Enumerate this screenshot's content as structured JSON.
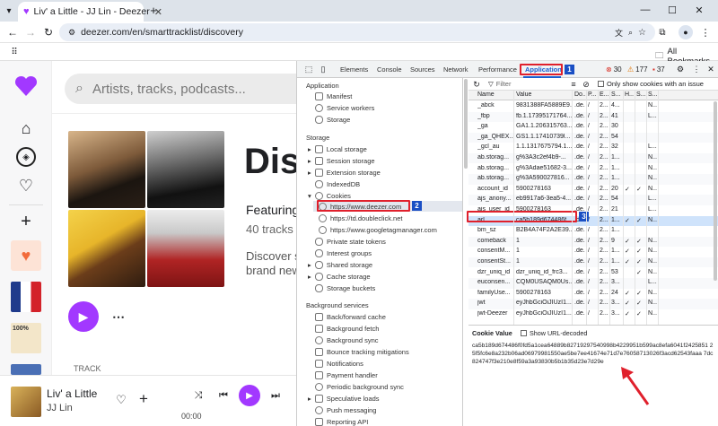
{
  "browser": {
    "tab_title": "Liv' a Little - JJ Lin - Deezer",
    "url": "deezer.com/en/smarttracklist/discovery",
    "bookmarks_label": "All Bookmarks"
  },
  "deezer": {
    "search_placeholder": "Artists, tracks, podcasts...",
    "page_title": "Dis",
    "featuring": "Featuring",
    "tracks_count": "40 tracks",
    "discover_line1": "Discover s",
    "discover_line2": "brand new",
    "track_header": "TRACK",
    "thumb_label": "100%",
    "player": {
      "song": "Liv' a Little",
      "artist": "JJ Lin",
      "time": "00:00"
    }
  },
  "devtools": {
    "tabs": [
      "Elements",
      "Console",
      "Sources",
      "Network",
      "Performance",
      "Application"
    ],
    "errors": "30",
    "warnings": "177",
    "issues": "37",
    "left": {
      "application_header": "Application",
      "application_items": [
        "Manifest",
        "Service workers",
        "Storage"
      ],
      "storage_header": "Storage",
      "storage_items": [
        "Local storage",
        "Session storage",
        "Extension storage",
        "IndexedDB",
        "Cookies"
      ],
      "cookie_items": [
        "https://www.deezer.com",
        "https://td.doubleclick.net",
        "https://www.googletagmanager.com"
      ],
      "storage_items2": [
        "Private state tokens",
        "Interest groups",
        "Shared storage",
        "Cache storage",
        "Storage buckets"
      ],
      "bg_header": "Background services",
      "bg_items": [
        "Back/forward cache",
        "Background fetch",
        "Background sync",
        "Bounce tracking mitigations",
        "Notifications",
        "Payment handler",
        "Periodic background sync",
        "Speculative loads",
        "Push messaging",
        "Reporting API"
      ]
    },
    "cookies_toolbar": {
      "filter_label": "Filter",
      "only_issue_label": "Only show cookies with an issue"
    },
    "columns": [
      "Name",
      "Value",
      "Do...",
      "P...",
      "E...",
      "S...",
      "H...",
      "S...",
      "S..."
    ],
    "rows": [
      {
        "name": "_abck",
        "value": "9831388FA5889E9...",
        "d": ".de...",
        "p": "/",
        "e": "2...",
        "s": "4...",
        "h": "",
        "sc": "",
        "ss": "N..."
      },
      {
        "name": "_fbp",
        "value": "fb.1.17395171764...",
        "d": ".de...",
        "p": "/",
        "e": "2...",
        "s": "41",
        "h": "",
        "sc": "",
        "ss": "L..."
      },
      {
        "name": "_ga",
        "value": "GA1.1.206315763...",
        "d": ".de...",
        "p": "/",
        "e": "2...",
        "s": "30",
        "h": "",
        "sc": "",
        "ss": ""
      },
      {
        "name": "_ga_QHEX...",
        "value": "GS1.1.17410739l...",
        "d": ".de...",
        "p": "/",
        "e": "2...",
        "s": "54",
        "h": "",
        "sc": "",
        "ss": ""
      },
      {
        "name": "_gcl_au",
        "value": "1.1.1317675794.1...",
        "d": ".de...",
        "p": "/",
        "e": "2...",
        "s": "32",
        "h": "",
        "sc": "",
        "ss": "L..."
      },
      {
        "name": "ab.storag...",
        "value": "g%3A3c2ef4b9-...",
        "d": ".de...",
        "p": "/",
        "e": "2...",
        "s": "1...",
        "h": "",
        "sc": "",
        "ss": "N..."
      },
      {
        "name": "ab.storag...",
        "value": "g%3Adae51682-3...",
        "d": ".de...",
        "p": "/",
        "e": "2...",
        "s": "1...",
        "h": "",
        "sc": "",
        "ss": "N..."
      },
      {
        "name": "ab.storag...",
        "value": "g%3A590027816...",
        "d": ".de...",
        "p": "/",
        "e": "2...",
        "s": "1...",
        "h": "",
        "sc": "",
        "ss": "N..."
      },
      {
        "name": "account_id",
        "value": "5900278163",
        "d": ".de...",
        "p": "/",
        "e": "2...",
        "s": "20",
        "h": "✓",
        "sc": "✓",
        "ss": "N..."
      },
      {
        "name": "ajs_anony...",
        "value": "eb9917a6-3ea5-4...",
        "d": ".de...",
        "p": "/",
        "e": "2...",
        "s": "54",
        "h": "",
        "sc": "",
        "ss": "L..."
      },
      {
        "name": "ajs_user_id",
        "value": "5900278163",
        "d": ".de...",
        "p": "/",
        "e": "2...",
        "s": "21",
        "h": "",
        "sc": "",
        "ss": "L..."
      },
      {
        "name": "arl",
        "value": "ca5b189d674486f...",
        "d": ".de...",
        "p": "/",
        "e": "2...",
        "s": "1...",
        "h": "✓",
        "sc": "✓",
        "ss": "N..."
      },
      {
        "name": "bm_sz",
        "value": "B2B4A74F2A2E39...",
        "d": ".de...",
        "p": "/",
        "e": "2...",
        "s": "1...",
        "h": "",
        "sc": "",
        "ss": ""
      },
      {
        "name": "comeback",
        "value": "1",
        "d": ".de...",
        "p": "/",
        "e": "2...",
        "s": "9",
        "h": "✓",
        "sc": "✓",
        "ss": "N..."
      },
      {
        "name": "consentM...",
        "value": "1",
        "d": ".de...",
        "p": "/",
        "e": "2...",
        "s": "1...",
        "h": "✓",
        "sc": "✓",
        "ss": "N..."
      },
      {
        "name": "consentSt...",
        "value": "1",
        "d": ".de...",
        "p": "/",
        "e": "2...",
        "s": "1...",
        "h": "✓",
        "sc": "✓",
        "ss": "N..."
      },
      {
        "name": "dzr_uniq_id",
        "value": "dzr_uniq_id_frc3...",
        "d": ".de...",
        "p": "/",
        "e": "2...",
        "s": "53",
        "h": "",
        "sc": "✓",
        "ss": "N..."
      },
      {
        "name": "euconsen...",
        "value": "CQM0USAQM0Us...",
        "d": ".de...",
        "p": "/",
        "e": "2...",
        "s": "3...",
        "h": "",
        "sc": "",
        "ss": "L..."
      },
      {
        "name": "familyUse...",
        "value": "5900278163",
        "d": ".de...",
        "p": "/",
        "e": "2...",
        "s": "24",
        "h": "✓",
        "sc": "✓",
        "ss": "N..."
      },
      {
        "name": "jwt",
        "value": "eyJhbGciOiJIUzI1...",
        "d": ".de...",
        "p": "/",
        "e": "2...",
        "s": "3...",
        "h": "✓",
        "sc": "✓",
        "ss": "N..."
      },
      {
        "name": "jwt-Deezer",
        "value": "eyJhbGciOiJIUzI1...",
        "d": ".de...",
        "p": "/",
        "e": "2...",
        "s": "3...",
        "h": "✓",
        "sc": "✓",
        "ss": "N..."
      }
    ],
    "cookie_value_label": "Cookie Value",
    "show_decoded_label": "Show URL-decoded",
    "cookie_value": "ca5b189d674486f0fd5a1cea64889b82719297540998b4229951b599ac8efa6041f2425851 25f5fc6e8a232b06ad06979981550ae5be7ee41674e71d7e76058713026f3acd62543faaa 7dc824747f3e210e8f59a3a93830b5b1b35d23e7d29e",
    "annotations": [
      "1",
      "2",
      "3"
    ]
  },
  "colors": {
    "deezer_purple": "#a238ff",
    "highlight_row": "#cfe3fb",
    "annotation_red": "#e0202c",
    "badge_blue": "#1a4fc4"
  }
}
